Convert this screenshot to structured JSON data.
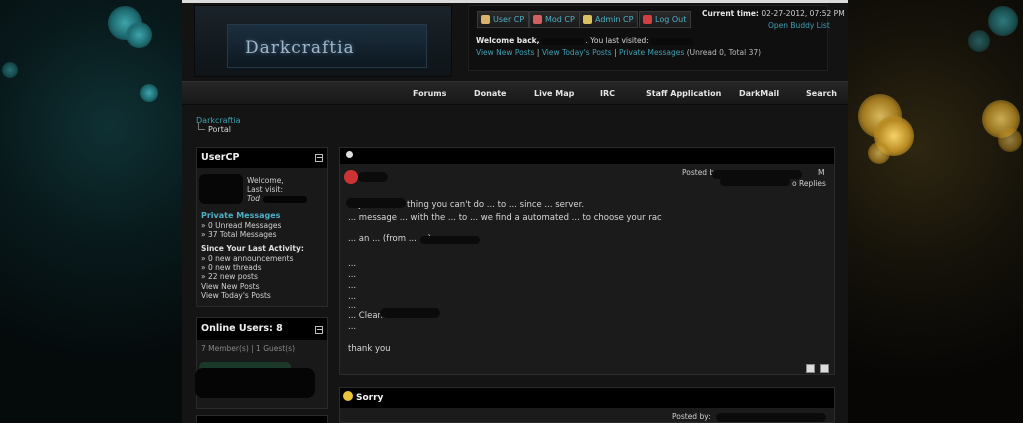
{
  "site": {
    "logo_text": "Darkcraftia"
  },
  "header": {
    "buttons": [
      {
        "label": "User CP",
        "icon": "user-icon",
        "color": "#d9b36a"
      },
      {
        "label": "Mod CP",
        "icon": "mod-icon",
        "color": "#d36060"
      },
      {
        "label": "Admin CP",
        "icon": "wand-icon",
        "color": "#d9c060"
      },
      {
        "label": "Log Out",
        "icon": "logout-icon",
        "color": "#d04040"
      }
    ],
    "welcome_prefix": "Welcome back,",
    "welcome_suffix": ". You last visited:",
    "link_new_posts": "View New Posts",
    "link_today_posts": "View Today's Posts",
    "link_private_messages": "Private Messages",
    "pm_counts": "(Unread 0, Total 37)",
    "separator": "|",
    "current_time_label": "Current time:",
    "current_time_value": "02-27-2012, 07:52 PM",
    "buddy_list": "Open Buddy List"
  },
  "nav": [
    "Forums",
    "Donate",
    "Live Map",
    "IRC",
    "Staff Application",
    "DarkMail",
    "Search"
  ],
  "breadcrumb": {
    "root": "Darkcraftia",
    "current": "Portal"
  },
  "usercp": {
    "title": "UserCP",
    "welcome": "Welcome, ",
    "last_visit": "Last visit:",
    "today": "Tod",
    "pm_title": "Private Messages",
    "unread": "» 0 Unread Messages",
    "total": "» 37 Total Messages",
    "since_title": "Since Your Last Activity:",
    "announcements": "» 0 new announcements",
    "threads": "» 0 new threads",
    "posts": "» 22 new posts",
    "view_new": "View New Posts",
    "view_today": "View Today's Posts"
  },
  "online": {
    "title": "Online Users: 8",
    "members_line": "7 Member(s) | 1 Guest(s)"
  },
  "posts": [
    {
      "title": "",
      "posted": "Posted b",
      "replies": "o Replies",
      "time_tail": "M",
      "lines": [
        "... just to ... a thing you can't do ... to ... since ... server.",
        "... message ... with the ... to ... we find a automated ... to choose your rac",
        "... an ... (from ... ...)",
        "...",
        "...",
        "...",
        "...",
        "...",
        "... CleanInventor ...",
        "..."
      ],
      "closing": "thank you"
    },
    {
      "title": "Sorry",
      "posted": "Posted by:"
    }
  ],
  "colors": {
    "accent": "#3ea0b4",
    "background": "#141414",
    "header_bar": "#000000"
  }
}
